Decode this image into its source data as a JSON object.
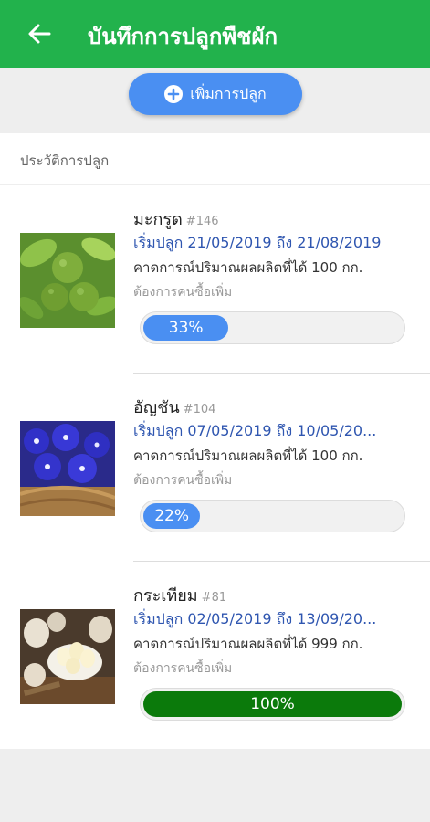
{
  "appbar": {
    "title": "บันทึกการปลูกพืชผัก",
    "back_icon": "arrow-left-icon"
  },
  "add_button": {
    "label": "เพิ่มการปลูก",
    "icon": "plus-circle-icon"
  },
  "history": {
    "title": "ประวัติการปลูก"
  },
  "items": [
    {
      "name": "มะกรูด",
      "code": "#146",
      "dates": "เริ่มปลูก 21/05/2019 ถึง 21/08/2019",
      "forecast": "คาดการณ์ปริมาณผลผลิตที่ได้ 100 กก.",
      "want": "ต้องการคนซื้อเพิ่ม",
      "progress": 33,
      "progress_label": "33%",
      "image": "kaffir-lime-photo"
    },
    {
      "name": "อัญชัน",
      "code": "#104",
      "dates": "เริ่มปลูก 07/05/2019 ถึง 10/05/20...",
      "forecast": "คาดการณ์ปริมาณผลผลิตที่ได้ 100 กก.",
      "want": "ต้องการคนซื้อเพิ่ม",
      "progress": 22,
      "progress_label": "22%",
      "image": "butterfly-pea-photo"
    },
    {
      "name": "กระเทียม",
      "code": "#81",
      "dates": "เริ่มปลูก 02/05/2019 ถึง 13/09/20...",
      "forecast": "คาดการณ์ปริมาณผลผลิตที่ได้ 999 กก.",
      "want": "ต้องการคนซื้อเพิ่ม",
      "progress": 100,
      "progress_label": "100%",
      "image": "garlic-photo"
    }
  ],
  "colors": {
    "appbar": "#22b24c",
    "accent": "#4a8ff2",
    "complete": "#0b7a0b",
    "date_text": "#2f56b0"
  }
}
